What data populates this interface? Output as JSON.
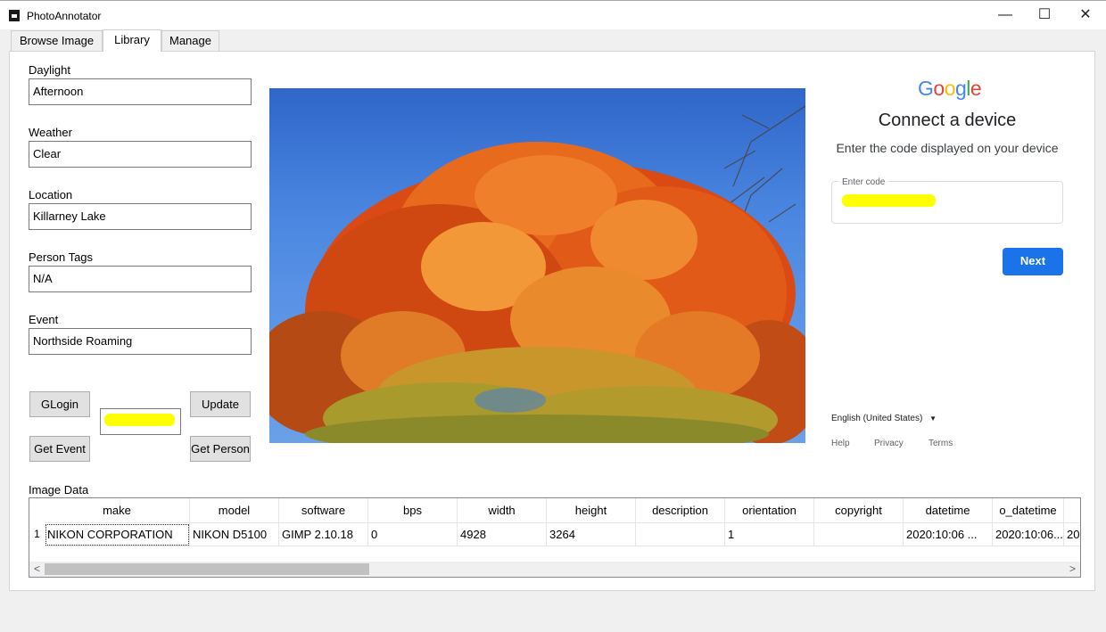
{
  "window": {
    "title": "PhotoAnnotator",
    "minimize": "—",
    "maximize": "☐",
    "close": "✕"
  },
  "tabs": [
    {
      "label": "Browse Image"
    },
    {
      "label": "Library"
    },
    {
      "label": "Manage"
    }
  ],
  "form": {
    "daylight": {
      "label": "Daylight",
      "value": "Afternoon"
    },
    "weather": {
      "label": "Weather",
      "value": "Clear"
    },
    "location": {
      "label": "Location",
      "value": "Killarney Lake"
    },
    "person_tags": {
      "label": "Person Tags",
      "value": "N/A"
    },
    "event": {
      "label": "Event",
      "value": "Northside Roaming"
    }
  },
  "buttons": {
    "glogin": "GLogin",
    "update": "Update",
    "get_event": "Get Event",
    "get_person": "Get Person"
  },
  "google": {
    "logo_letters": [
      {
        "ch": "G",
        "color": "#4285F4"
      },
      {
        "ch": "o",
        "color": "#EA4335"
      },
      {
        "ch": "o",
        "color": "#FBBC05"
      },
      {
        "ch": "g",
        "color": "#4285F4"
      },
      {
        "ch": "l",
        "color": "#34A853"
      },
      {
        "ch": "e",
        "color": "#EA4335"
      }
    ],
    "title": "Connect a device",
    "subtitle": "Enter the code displayed on your device",
    "code_label": "Enter code",
    "next_label": "Next",
    "language": "English (United States)",
    "footer": {
      "help": "Help",
      "privacy": "Privacy",
      "terms": "Terms"
    }
  },
  "image_data": {
    "label": "Image Data",
    "columns": [
      "make",
      "model",
      "software",
      "bps",
      "width",
      "height",
      "description",
      "orientation",
      "copyright",
      "datetime",
      "o_datetime",
      ""
    ],
    "rows": [
      {
        "num": "1",
        "cells": [
          "NIKON CORPORATION",
          "NIKON D5100",
          "GIMP 2.10.18",
          "0",
          "4928",
          "3264",
          "",
          "1",
          "",
          "2020:10:06 ...",
          "2020:10:06...",
          "20"
        ]
      }
    ]
  },
  "colors": {
    "accent": "#1a73e8",
    "highlight": "#ffff00"
  }
}
